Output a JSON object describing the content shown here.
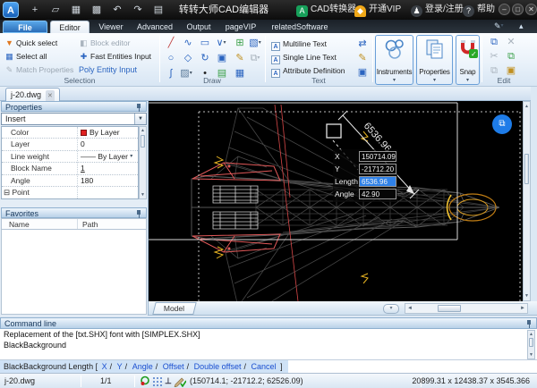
{
  "titlebar": {
    "logo": "A",
    "title": "转转大师CAD编辑器",
    "icons": [
      {
        "name": "new",
        "glyph": "+"
      },
      {
        "name": "open",
        "glyph": "▱"
      },
      {
        "name": "save",
        "glyph": "▦"
      },
      {
        "name": "save-as",
        "glyph": "▩"
      },
      {
        "name": "undo",
        "glyph": "↶"
      },
      {
        "name": "redo",
        "glyph": "↷"
      },
      {
        "name": "print",
        "glyph": "▤"
      }
    ],
    "converter": "CAD转换器",
    "converter_badge": "A",
    "vip": "开通VIP",
    "login": "登录/注册",
    "help": "帮助",
    "win_min": "–",
    "win_max": "□",
    "win_close": "✕"
  },
  "menu": {
    "tabs": [
      "File",
      "Editor",
      "Viewer",
      "Advanced",
      "Output",
      "pageVIP",
      "relatedSoftware"
    ],
    "pencil_tool": "✎",
    "collapse_tool": "▴"
  },
  "ribbon": {
    "selection": {
      "label": "Selection",
      "items": [
        "Quick select",
        "Select all",
        "Match Properties",
        "Block editor",
        "Fast Entities Input",
        "Poly Entity Input"
      ],
      "item_icons": [
        "▼",
        "▦",
        "✎",
        "◧",
        "✚",
        "▱"
      ]
    },
    "draw": {
      "label": "Draw",
      "icons": [
        {
          "name": "line",
          "glyph": "╱"
        },
        {
          "name": "spline-pen",
          "glyph": "∿"
        },
        {
          "name": "rectangle",
          "glyph": "▭"
        },
        {
          "name": "polyline",
          "glyph": "∨"
        },
        {
          "name": "block-insert",
          "glyph": "⊞"
        },
        {
          "name": "selection-area",
          "glyph": "▧"
        },
        {
          "name": "circle",
          "glyph": "○"
        },
        {
          "name": "polygon",
          "glyph": "◇"
        },
        {
          "name": "arc",
          "glyph": "↻"
        },
        {
          "name": "ole-object",
          "glyph": "▣"
        },
        {
          "name": "sketch-pen",
          "glyph": "✎"
        },
        {
          "name": "copy-object",
          "glyph": "⧉"
        },
        {
          "name": "spline-curve",
          "glyph": "∫"
        },
        {
          "name": "hatch",
          "glyph": "▨"
        },
        {
          "name": "point",
          "glyph": "•"
        },
        {
          "name": "raster-image",
          "glyph": "▤"
        },
        {
          "name": "table",
          "glyph": "▦"
        }
      ],
      "dropdown": "▾"
    },
    "text": {
      "label": "Text",
      "items": [
        "Multiline Text",
        "Single Line Text",
        "Attribute Definition"
      ],
      "box_icon": "A",
      "side_icons": [
        "⇄",
        "✎",
        "▣"
      ]
    },
    "big_buttons": [
      "Instruments",
      "Properties",
      "Snap"
    ],
    "edit": {
      "label": "Edit",
      "icons": [
        {
          "name": "paste",
          "glyph": "⧉"
        },
        {
          "name": "delete",
          "glyph": "✕"
        },
        {
          "name": "cut",
          "glyph": "✂"
        },
        {
          "name": "copy-ok",
          "glyph": "⧉"
        },
        {
          "name": "copy-duplicate",
          "glyph": "⧉"
        },
        {
          "name": "block-attributes",
          "glyph": "▣"
        }
      ]
    }
  },
  "doc_tab": {
    "label": "j-20.dwg",
    "close": "✕"
  },
  "properties_panel": {
    "title": "Properties",
    "selector": "Insert",
    "rows": [
      {
        "label": "Color",
        "value": "By Layer"
      },
      {
        "label": "Layer",
        "value": "0"
      },
      {
        "label": "Line weight",
        "value": "By Layer",
        "prefix": "——",
        "dropdown": "▾"
      },
      {
        "label": "Block Name",
        "value": "1"
      },
      {
        "label": "Angle",
        "value": "180"
      },
      {
        "label": "Point",
        "value": "",
        "collapse": "⊟"
      }
    ]
  },
  "favorites_panel": {
    "title": "Favorites",
    "col_name": "Name",
    "col_path": "Path"
  },
  "canvas": {
    "model_tab": "Model",
    "dim_text": "6536.96",
    "convert_button": "⧉",
    "tooltip": {
      "rows": [
        {
          "label": "X",
          "value": "150714.09"
        },
        {
          "label": "Y",
          "value": "-21712.20"
        },
        {
          "label": "Length",
          "value": "6536.96"
        },
        {
          "label": "Angle",
          "value": "42.90"
        }
      ]
    }
  },
  "command_line": {
    "title": "Command line",
    "lines": [
      "Replacement of the [txt.SHX] font with [SIMPLEX.SHX]",
      "BlackBackground"
    ],
    "prompt": {
      "prefix": "BlackBackground  Length  [",
      "options": [
        "X",
        "Y",
        "Angle",
        "Offset",
        "Double offset",
        "Cancel"
      ],
      "sep": "/",
      "suffix": "]"
    }
  },
  "status_bar": {
    "file": "j-20.dwg",
    "page": "1/1",
    "perp_icon": "⊥",
    "coords": "(150714.1; -21712.2; 62526.09)",
    "dimensions": "20899.31 x 12438.37 x 3545.366"
  },
  "ui": {
    "up": "▲",
    "down": "▼",
    "left": "◄",
    "right": "►",
    "caret": "▾",
    "chevrons": "▾▾"
  },
  "colors": {
    "accent_blue": "#2f81e8",
    "selection_blue": "#2f81e8",
    "highlight_red": "#d84848",
    "nose_orange": "#d99b1e",
    "canvas_bg": "#000000",
    "vip_orange": "#f0a818",
    "brand_green": "#17a05a"
  }
}
